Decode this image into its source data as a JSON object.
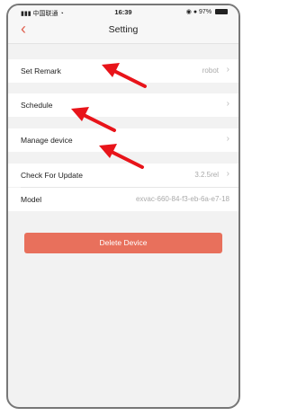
{
  "status_bar": {
    "carrier": "中国联通",
    "time": "16:39",
    "battery": "97%"
  },
  "header": {
    "back_icon": "chevron-left-icon",
    "title": "Setting"
  },
  "rows": [
    {
      "label": "Set Remark",
      "value": "robot"
    },
    {
      "label": "Schedule",
      "value": ""
    },
    {
      "label": "Manage device",
      "value": ""
    },
    {
      "label": "Check For Update",
      "value": "3.2.5rel"
    },
    {
      "label": "Model",
      "value": "exvac-660-84-f3-eb-6a-e7-18"
    }
  ],
  "delete_button": "Delete Device",
  "colors": {
    "accent": "#e0604f",
    "delete_bg": "#e8705c",
    "arrow": "#e8141a"
  }
}
